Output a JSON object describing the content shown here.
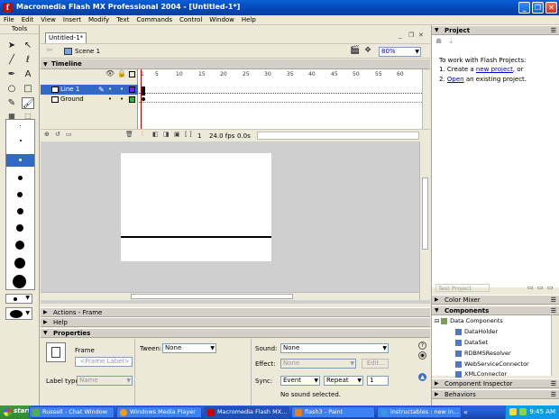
{
  "window": {
    "title": "Macromedia Flash MX Professional 2004 - [Untitled-1*]",
    "app_icon": "f"
  },
  "menu": [
    "File",
    "Edit",
    "View",
    "Insert",
    "Modify",
    "Text",
    "Commands",
    "Control",
    "Window",
    "Help"
  ],
  "tools": {
    "title": "Tools"
  },
  "document": {
    "tab": "Untitled-1*",
    "scene": "Scene 1",
    "zoom": "80%"
  },
  "timeline": {
    "title": "Timeline",
    "frame_numbers": [
      "1",
      "5",
      "10",
      "15",
      "20",
      "25",
      "30",
      "35",
      "40",
      "45",
      "50",
      "55",
      "60"
    ],
    "layers": [
      {
        "name": "Line 1",
        "selected": true
      },
      {
        "name": "Ground",
        "selected": false
      }
    ],
    "footer": {
      "frame": "1",
      "fps": "24.0 fps",
      "time": "0.0s"
    }
  },
  "panels": {
    "actions": "Actions - Frame",
    "help": "Help",
    "properties": "Properties"
  },
  "properties": {
    "frame_label": "Frame",
    "frame_placeholder": "<Frame Label>",
    "label_type_label": "Label type:",
    "label_type_value": "Name",
    "tween_label": "Tween:",
    "tween_value": "None",
    "sound_label": "Sound:",
    "sound_value": "None",
    "effect_label": "Effect:",
    "effect_value": "None",
    "edit_button": "Edit...",
    "sync_label": "Sync:",
    "sync_value": "Event",
    "repeat_value": "Repeat",
    "repeat_count": "1",
    "sound_status": "No sound selected."
  },
  "project": {
    "title": "Project",
    "intro": "To work with Flash Projects:",
    "step1_prefix": "1. Create a ",
    "step1_link": "new project",
    "step1_suffix": ", or",
    "step2_prefix": "2. ",
    "step2_link": "Open",
    "step2_suffix": " an existing project.",
    "test_project": "Test Project"
  },
  "right_panels": {
    "color_mixer": "Color Mixer",
    "components": "Components",
    "component_inspector": "Component Inspector",
    "behaviors": "Behaviors"
  },
  "components": {
    "group": "Data Components",
    "items": [
      "DataHolder",
      "DataSet",
      "RDBMSResolver",
      "WebServiceConnector",
      "XMLConnector"
    ]
  },
  "taskbar": {
    "start": "start",
    "tasks": [
      "Russell - Chat Window",
      "Windows Media Player",
      "Macromedia Flash MX...",
      "flash3 - Paint",
      "instructables : new in..."
    ],
    "clock": "9:45 AM"
  },
  "colors": {
    "titlebar": "#0447b4",
    "selection": "#316ac5",
    "playhead": "#cc0000",
    "taskbar": "#245dd8"
  }
}
